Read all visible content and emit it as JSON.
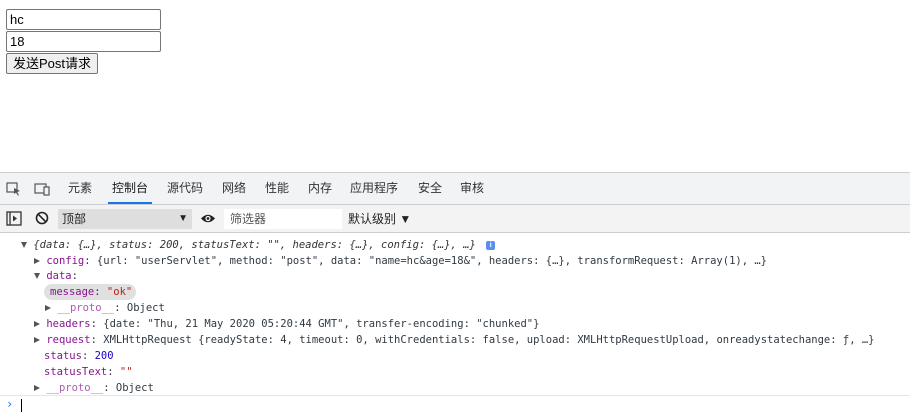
{
  "page": {
    "input1_value": "hc",
    "input2_value": "18",
    "post_button_label": "发送Post请求"
  },
  "devtools": {
    "tabs": [
      "元素",
      "控制台",
      "源代码",
      "网络",
      "性能",
      "内存",
      "应用程序",
      "安全",
      "审核"
    ],
    "active_tab": "控制台",
    "context_select": "顶部",
    "filter_placeholder": "筛选器",
    "levels_label": "默认级别 ▼"
  },
  "console": {
    "summary": "{data: {…}, status: 200, statusText: \"\", headers: {…}, config: {…}, …}",
    "config_key": "config",
    "config_value": "{url: \"userServlet\", method: \"post\", data: \"name=hc&age=18&\", headers: {…}, transformRequest: Array(1), …}",
    "data_key": "data",
    "message_key": "message",
    "message_value": "\"ok\"",
    "data_proto_key": "__proto__",
    "data_proto_value": "Object",
    "headers_key": "headers",
    "headers_value": "{date: \"Thu, 21 May 2020 05:20:44 GMT\", transfer-encoding: \"chunked\"}",
    "request_key": "request",
    "request_value": "XMLHttpRequest {readyState: 4, timeout: 0, withCredentials: false, upload: XMLHttpRequestUpload, onreadystatechange: ƒ, …}",
    "status_key": "status",
    "status_value": "200",
    "statustext_key": "statusText",
    "statustext_value": "\"\"",
    "proto_key": "__proto__",
    "proto_value": "Object",
    "prompt_symbol": "›"
  },
  "colors": {
    "accent": "#1a73e8",
    "key_purple": "#881391",
    "string_red": "#c41a16",
    "number_blue": "#1c00cf"
  }
}
